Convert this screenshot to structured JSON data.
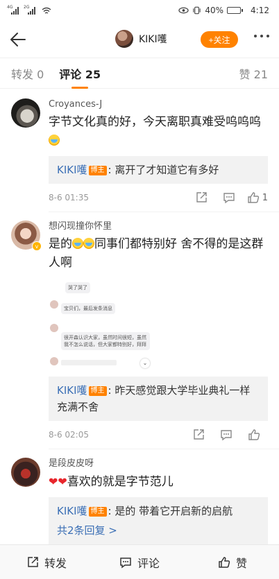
{
  "status_bar": {
    "signal_tags": [
      "4G",
      "2G"
    ],
    "battery_percent": "40%",
    "battery_level": 0.4,
    "time": "4:12"
  },
  "header": {
    "title": "KIKI嚄",
    "follow_label": "+关注",
    "accent_color": "#ff8200"
  },
  "tabs": {
    "repost": "转发 0",
    "comments": "评论 25",
    "likes": "赞 21"
  },
  "comments": [
    {
      "name": "Croyances-J",
      "text_before": "字节文化真的好，今天离职真难受呜呜呜",
      "reply": {
        "name": "KIKI嚄",
        "badge": "博主",
        "text": "离开了才知道它有多好"
      },
      "time": "8-6 01:35",
      "like_count": "1"
    },
    {
      "name": "想闪现撞你怀里",
      "text_part1": "是的",
      "text_part2": "同事们都特别好 舍不得的是这群人啊",
      "embedded_lines": [
        "哭了哭了",
        "宝贝们，最后发条消息",
        "很开森认识大家，虽然时间很短，虽然我不怎么说话，但大家都特别好，拜拜"
      ],
      "reply": {
        "name": "KIKI嚄",
        "badge": "博主",
        "text": "昨天感觉跟大学毕业典礼一样充满不舍"
      },
      "time": "8-6 02:05"
    },
    {
      "name": "是段皮皮呀",
      "text": "喜欢的就是字节范儿",
      "reply": {
        "name": "KIKI嚄",
        "badge": "博主",
        "text": "是的 带着它开启新的启航",
        "more": "共2条回复 >"
      }
    }
  ],
  "bottom_bar": {
    "repost": "转发",
    "comment": "评论",
    "like": "赞"
  }
}
